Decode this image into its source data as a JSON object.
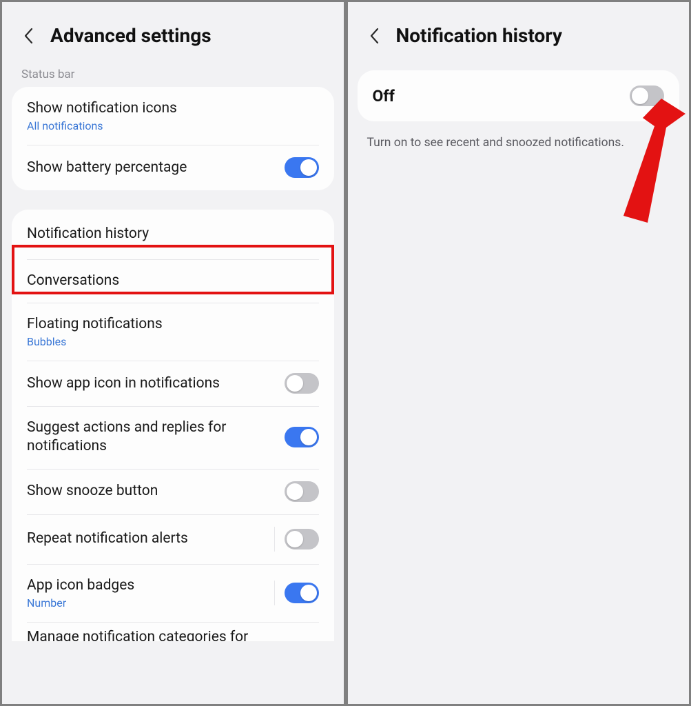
{
  "left": {
    "title": "Advanced settings",
    "section_label": "Status bar",
    "card1": {
      "row0": {
        "title": "Show notification icons",
        "sub": "All notifications"
      },
      "row1": {
        "title": "Show battery percentage"
      }
    },
    "card2": {
      "row0": {
        "title": "Notification history"
      },
      "row1": {
        "title": "Conversations"
      },
      "row2": {
        "title": "Floating notifications",
        "sub": "Bubbles"
      },
      "row3": {
        "title": "Show app icon in notifications"
      },
      "row4": {
        "title": "Suggest actions and replies for notifications"
      },
      "row5": {
        "title": "Show snooze button"
      },
      "row6": {
        "title": "Repeat notification alerts"
      },
      "row7": {
        "title": "App icon badges",
        "sub": "Number"
      }
    },
    "truncated": "Manage notification categories for"
  },
  "right": {
    "title": "Notification history",
    "status": "Off",
    "help": "Turn on to see recent and snoozed notifications."
  }
}
